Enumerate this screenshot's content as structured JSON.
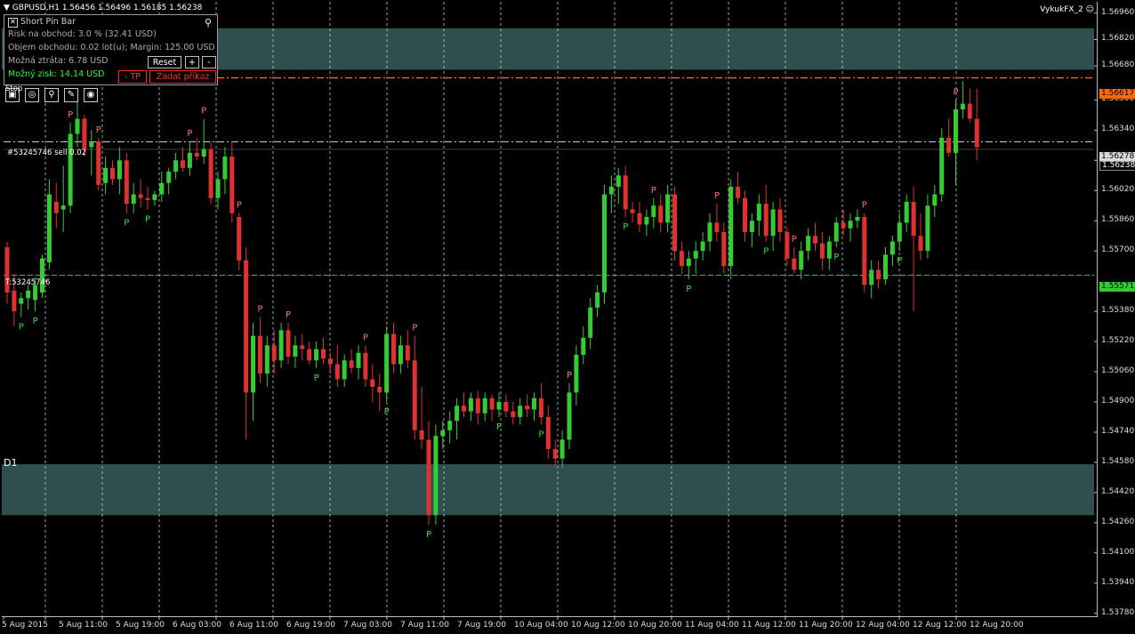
{
  "header": {
    "symbol": "GBPUSD,H1",
    "ohlc": "1.56456 1.56496 1.56185 1.56238",
    "broker": "VykukFX_2 ☺"
  },
  "panel": {
    "title": "Short Pin Bar",
    "risk": "Risk na obchod: 3.0 % (32.41 USD)",
    "volume": "Objem obchodu: 0.02 lot(u); Margin: 125.00 USD",
    "loss": "Možná ztráta: 6.78 USD",
    "profit": "Možný zisk: 14.14 USD",
    "reset_label": "Reset",
    "plus_label": "+",
    "minus_label": "-",
    "tp_label": "- TP",
    "order_label": "Zadat příkaz",
    "close_icon": "close-icon",
    "pin_icon": "pin-icon"
  },
  "labels": {
    "stop_line": "Stop",
    "sell_line": "#53245746 sell 0.02",
    "take_line": "T:53245746",
    "d1": "D1"
  },
  "price_axis": [
    "1.56960",
    "1.56820",
    "1.56680",
    "1.56617",
    "1.56500",
    "1.56340",
    "1.56278",
    "1.56238",
    "1.56180",
    "1.56020",
    "1.55860",
    "1.55700",
    "1.55571",
    "1.55380",
    "1.55220",
    "1.55060",
    "1.54900",
    "1.54740",
    "1.54580",
    "1.54420",
    "1.54260",
    "1.54100",
    "1.53940",
    "1.53780"
  ],
  "time_axis": [
    "5 Aug 2015",
    "5 Aug 11:00",
    "5 Aug 19:00",
    "6 Aug 03:00",
    "6 Aug 11:00",
    "6 Aug 19:00",
    "7 Aug 03:00",
    "7 Aug 11:00",
    "7 Aug 19:00",
    "10 Aug 04:00",
    "10 Aug 12:00",
    "10 Aug 20:00",
    "11 Aug 04:00",
    "11 Aug 12:00",
    "11 Aug 20:00",
    "12 Aug 04:00",
    "12 Aug 12:00",
    "12 Aug 20:00"
  ],
  "highlights": {
    "stop_price": "1.56617",
    "entry_price": "1.56278",
    "bid_price": "1.56238",
    "tp_price": "1.55571"
  },
  "colors": {
    "bull": "#33cc33",
    "bear": "#e03030",
    "zone": "#2f4f4f",
    "stop": "#ff6a00",
    "entry": "#cccccc",
    "tp": "#33cc33",
    "pin_bear": "#ff7070",
    "pin_bull": "#33dd33",
    "grid": "#c8c8c8"
  },
  "chart_data": {
    "type": "candlestick",
    "symbol": "GBPUSD",
    "timeframe": "H1",
    "ylim": [
      1.5376,
      1.5702
    ],
    "zones": [
      [
        1.5666,
        1.5688
      ],
      [
        1.543,
        1.5457
      ]
    ],
    "levels": {
      "stop": 1.56617,
      "entry": 1.56278,
      "bid": 1.56238,
      "take_profit": 1.55571
    },
    "candles": [
      [
        1.5572,
        1.5575,
        1.5542,
        1.5548
      ],
      [
        1.5549,
        1.5558,
        1.553,
        1.5538
      ],
      [
        1.5542,
        1.5548,
        1.5535,
        1.5545
      ],
      [
        1.5545,
        1.5552,
        1.5539,
        1.5549
      ],
      [
        1.5544,
        1.5556,
        1.5538,
        1.5552
      ],
      [
        1.5548,
        1.5568,
        1.5545,
        1.5566
      ],
      [
        1.5564,
        1.5608,
        1.556,
        1.56
      ],
      [
        1.5596,
        1.5606,
        1.5582,
        1.559
      ],
      [
        1.5592,
        1.5615,
        1.558,
        1.5594
      ],
      [
        1.5594,
        1.5638,
        1.559,
        1.5632
      ],
      [
        1.5632,
        1.5652,
        1.5625,
        1.564
      ],
      [
        1.564,
        1.5642,
        1.562,
        1.5624
      ],
      [
        1.5625,
        1.5634,
        1.561,
        1.5628
      ],
      [
        1.5628,
        1.563,
        1.5602,
        1.5605
      ],
      [
        1.5606,
        1.562,
        1.56,
        1.5614
      ],
      [
        1.5614,
        1.5618,
        1.5605,
        1.5608
      ],
      [
        1.5608,
        1.5625,
        1.56,
        1.5618
      ],
      [
        1.5618,
        1.5622,
        1.559,
        1.5595
      ],
      [
        1.5595,
        1.5606,
        1.559,
        1.56
      ],
      [
        1.56,
        1.5608,
        1.5593,
        1.5598
      ],
      [
        1.5598,
        1.5604,
        1.5592,
        1.5597
      ],
      [
        1.5597,
        1.5602,
        1.5594,
        1.56
      ],
      [
        1.56,
        1.5612,
        1.5596,
        1.5606
      ],
      [
        1.5606,
        1.5614,
        1.56,
        1.5612
      ],
      [
        1.5612,
        1.5622,
        1.5608,
        1.5618
      ],
      [
        1.5618,
        1.5625,
        1.5612,
        1.5614
      ],
      [
        1.5614,
        1.5628,
        1.561,
        1.5622
      ],
      [
        1.5622,
        1.563,
        1.5618,
        1.562
      ],
      [
        1.562,
        1.564,
        1.5616,
        1.5624
      ],
      [
        1.5624,
        1.5628,
        1.5595,
        1.5598
      ],
      [
        1.5598,
        1.5612,
        1.5592,
        1.5608
      ],
      [
        1.5608,
        1.5625,
        1.56,
        1.562
      ],
      [
        1.562,
        1.5628,
        1.5585,
        1.559
      ],
      [
        1.5588,
        1.559,
        1.556,
        1.5565
      ],
      [
        1.5565,
        1.5572,
        1.547,
        1.5495
      ],
      [
        1.5495,
        1.5532,
        1.548,
        1.5525
      ],
      [
        1.5525,
        1.5535,
        1.55,
        1.5505
      ],
      [
        1.5505,
        1.5525,
        1.5498,
        1.552
      ],
      [
        1.552,
        1.5528,
        1.5505,
        1.5512
      ],
      [
        1.5512,
        1.5532,
        1.5508,
        1.5528
      ],
      [
        1.5528,
        1.5532,
        1.551,
        1.5514
      ],
      [
        1.5514,
        1.5525,
        1.5508,
        1.552
      ],
      [
        1.552,
        1.5526,
        1.5512,
        1.5518
      ],
      [
        1.5518,
        1.5522,
        1.551,
        1.5512
      ],
      [
        1.5512,
        1.5522,
        1.5508,
        1.5518
      ],
      [
        1.5518,
        1.5524,
        1.551,
        1.5513
      ],
      [
        1.5513,
        1.5516,
        1.5505,
        1.551
      ],
      [
        1.551,
        1.552,
        1.5498,
        1.5502
      ],
      [
        1.5502,
        1.5515,
        1.5498,
        1.5512
      ],
      [
        1.5512,
        1.5518,
        1.5505,
        1.5508
      ],
      [
        1.5508,
        1.552,
        1.5502,
        1.5516
      ],
      [
        1.5516,
        1.552,
        1.5498,
        1.5502
      ],
      [
        1.5502,
        1.551,
        1.549,
        1.5498
      ],
      [
        1.5498,
        1.5505,
        1.5485,
        1.5495
      ],
      [
        1.5495,
        1.553,
        1.549,
        1.5526
      ],
      [
        1.5526,
        1.5532,
        1.5505,
        1.551
      ],
      [
        1.551,
        1.5525,
        1.5505,
        1.552
      ],
      [
        1.552,
        1.5528,
        1.5508,
        1.5512
      ],
      [
        1.5512,
        1.5525,
        1.547,
        1.5475
      ],
      [
        1.5475,
        1.5498,
        1.5465,
        1.547
      ],
      [
        1.547,
        1.548,
        1.5425,
        1.543
      ],
      [
        1.543,
        1.5478,
        1.5425,
        1.5472
      ],
      [
        1.5472,
        1.548,
        1.5465,
        1.5475
      ],
      [
        1.5475,
        1.5485,
        1.5468,
        1.548
      ],
      [
        1.548,
        1.5492,
        1.547,
        1.5488
      ],
      [
        1.5488,
        1.5495,
        1.5482,
        1.5485
      ],
      [
        1.5485,
        1.5495,
        1.548,
        1.5492
      ],
      [
        1.5492,
        1.5496,
        1.5478,
        1.5484
      ],
      [
        1.5484,
        1.5495,
        1.548,
        1.5492
      ],
      [
        1.5492,
        1.5494,
        1.548,
        1.5486
      ],
      [
        1.5486,
        1.5495,
        1.5482,
        1.549
      ],
      [
        1.549,
        1.5494,
        1.5482,
        1.5485
      ],
      [
        1.5485,
        1.549,
        1.5478,
        1.5482
      ],
      [
        1.5482,
        1.5492,
        1.5478,
        1.5488
      ],
      [
        1.5488,
        1.5494,
        1.5482,
        1.5486
      ],
      [
        1.5486,
        1.5495,
        1.548,
        1.5492
      ],
      [
        1.5492,
        1.55,
        1.5478,
        1.5482
      ],
      [
        1.5482,
        1.5488,
        1.546,
        1.5465
      ],
      [
        1.5465,
        1.547,
        1.5455,
        1.546
      ],
      [
        1.546,
        1.5475,
        1.5455,
        1.547
      ],
      [
        1.547,
        1.55,
        1.5465,
        1.5495
      ],
      [
        1.5495,
        1.552,
        1.5488,
        1.5515
      ],
      [
        1.5515,
        1.553,
        1.551,
        1.5524
      ],
      [
        1.5524,
        1.5545,
        1.5518,
        1.554
      ],
      [
        1.554,
        1.5552,
        1.5535,
        1.5548
      ],
      [
        1.5548,
        1.5605,
        1.5542,
        1.56
      ],
      [
        1.56,
        1.561,
        1.559,
        1.5604
      ],
      [
        1.5604,
        1.5614,
        1.5595,
        1.561
      ],
      [
        1.561,
        1.5615,
        1.5588,
        1.5592
      ],
      [
        1.5592,
        1.5596,
        1.5585,
        1.559
      ],
      [
        1.559,
        1.5596,
        1.558,
        1.5584
      ],
      [
        1.5584,
        1.5592,
        1.5578,
        1.5588
      ],
      [
        1.5588,
        1.5598,
        1.5582,
        1.5594
      ],
      [
        1.5594,
        1.56,
        1.558,
        1.5585
      ],
      [
        1.5585,
        1.5605,
        1.558,
        1.56
      ],
      [
        1.56,
        1.5604,
        1.5565,
        1.557
      ],
      [
        1.557,
        1.5575,
        1.5558,
        1.5562
      ],
      [
        1.5562,
        1.557,
        1.5555,
        1.5566
      ],
      [
        1.5566,
        1.5575,
        1.5558,
        1.557
      ],
      [
        1.557,
        1.558,
        1.5565,
        1.5575
      ],
      [
        1.5575,
        1.559,
        1.557,
        1.5585
      ],
      [
        1.5585,
        1.5595,
        1.5575,
        1.558
      ],
      [
        1.558,
        1.5585,
        1.5558,
        1.5562
      ],
      [
        1.5562,
        1.5608,
        1.5555,
        1.5604
      ],
      [
        1.5604,
        1.5612,
        1.5595,
        1.5598
      ],
      [
        1.5598,
        1.5602,
        1.5575,
        1.558
      ],
      [
        1.558,
        1.559,
        1.5572,
        1.5586
      ],
      [
        1.5586,
        1.56,
        1.5578,
        1.5595
      ],
      [
        1.5595,
        1.5605,
        1.5575,
        1.5578
      ],
      [
        1.5578,
        1.5596,
        1.557,
        1.5592
      ],
      [
        1.5592,
        1.5598,
        1.5575,
        1.558
      ],
      [
        1.558,
        1.5582,
        1.5562,
        1.5566
      ],
      [
        1.5566,
        1.5572,
        1.5558,
        1.556
      ],
      [
        1.556,
        1.5575,
        1.5555,
        1.557
      ],
      [
        1.557,
        1.5582,
        1.5565,
        1.5578
      ],
      [
        1.5578,
        1.5585,
        1.557,
        1.5574
      ],
      [
        1.5574,
        1.558,
        1.556,
        1.5566
      ],
      [
        1.5566,
        1.5578,
        1.556,
        1.5575
      ],
      [
        1.5575,
        1.5588,
        1.5572,
        1.5585
      ],
      [
        1.5585,
        1.5592,
        1.5578,
        1.5582
      ],
      [
        1.5582,
        1.559,
        1.5575,
        1.5586
      ],
      [
        1.5586,
        1.5592,
        1.5582,
        1.5588
      ],
      [
        1.5588,
        1.559,
        1.5548,
        1.5552
      ],
      [
        1.5552,
        1.5565,
        1.5545,
        1.556
      ],
      [
        1.556,
        1.5565,
        1.555,
        1.5555
      ],
      [
        1.5555,
        1.5572,
        1.5552,
        1.5568
      ],
      [
        1.5568,
        1.5578,
        1.5562,
        1.5575
      ],
      [
        1.5575,
        1.559,
        1.557,
        1.5585
      ],
      [
        1.5585,
        1.56,
        1.558,
        1.5596
      ],
      [
        1.5596,
        1.5604,
        1.5538,
        1.5578
      ],
      [
        1.5578,
        1.559,
        1.5565,
        1.557
      ],
      [
        1.557,
        1.56,
        1.5566,
        1.5594
      ],
      [
        1.5594,
        1.5605,
        1.5588,
        1.56
      ],
      [
        1.56,
        1.5635,
        1.5596,
        1.563
      ],
      [
        1.563,
        1.564,
        1.562,
        1.5622
      ],
      [
        1.5622,
        1.565,
        1.5605,
        1.5645
      ],
      [
        1.5645,
        1.566,
        1.564,
        1.5648
      ],
      [
        1.5648,
        1.5656,
        1.5638,
        1.564
      ],
      [
        1.564,
        1.5656,
        1.5618,
        1.5625
      ]
    ],
    "pin_markers": [
      {
        "index": 2,
        "kind": "bull"
      },
      {
        "index": 4,
        "kind": "bull"
      },
      {
        "index": 9,
        "kind": "bear"
      },
      {
        "index": 13,
        "kind": "bear"
      },
      {
        "index": 17,
        "kind": "bull"
      },
      {
        "index": 20,
        "kind": "bull"
      },
      {
        "index": 26,
        "kind": "bear"
      },
      {
        "index": 28,
        "kind": "bear"
      },
      {
        "index": 33,
        "kind": "bear"
      },
      {
        "index": 36,
        "kind": "bear"
      },
      {
        "index": 40,
        "kind": "bear"
      },
      {
        "index": 44,
        "kind": "bull"
      },
      {
        "index": 51,
        "kind": "bear"
      },
      {
        "index": 54,
        "kind": "bull"
      },
      {
        "index": 58,
        "kind": "bear"
      },
      {
        "index": 60,
        "kind": "bull"
      },
      {
        "index": 70,
        "kind": "bull"
      },
      {
        "index": 76,
        "kind": "bull"
      },
      {
        "index": 80,
        "kind": "bear"
      },
      {
        "index": 88,
        "kind": "bull"
      },
      {
        "index": 92,
        "kind": "bear"
      },
      {
        "index": 97,
        "kind": "bull"
      },
      {
        "index": 101,
        "kind": "bear"
      },
      {
        "index": 108,
        "kind": "bull"
      },
      {
        "index": 112,
        "kind": "bear"
      },
      {
        "index": 118,
        "kind": "bull"
      },
      {
        "index": 122,
        "kind": "bear"
      },
      {
        "index": 127,
        "kind": "bull"
      },
      {
        "index": 135,
        "kind": "bear"
      }
    ]
  }
}
